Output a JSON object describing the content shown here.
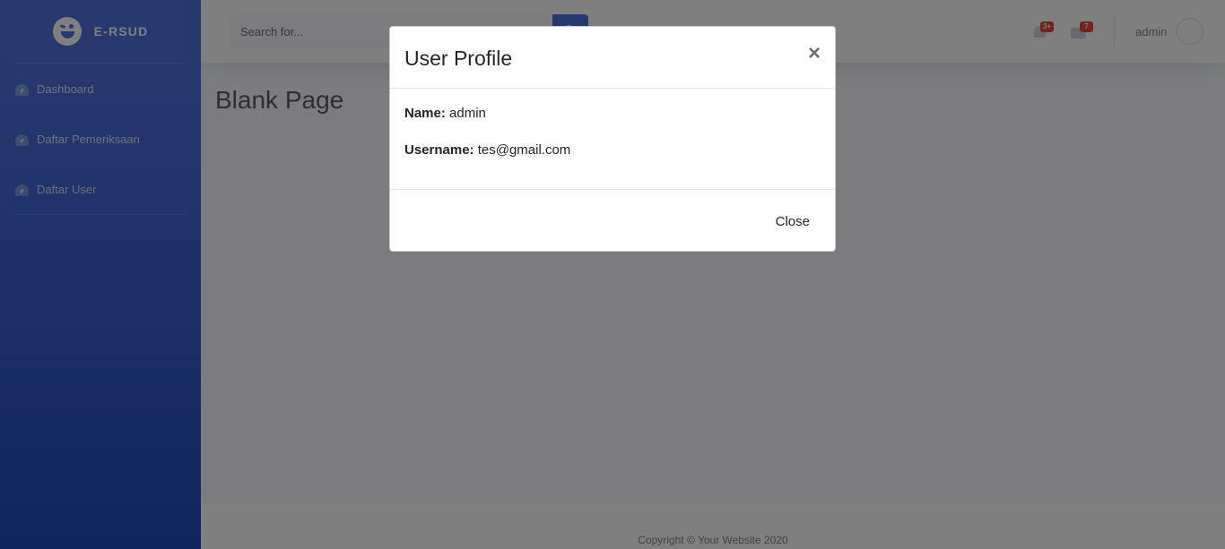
{
  "sidebar": {
    "brand": "E-RSUD",
    "items": [
      {
        "label": "Dashboard"
      },
      {
        "label": "Daftar Pemeriksaan"
      },
      {
        "label": "Daftar User"
      }
    ]
  },
  "topbar": {
    "search_placeholder": "Search for...",
    "alerts_badge": "3+",
    "messages_badge": "7",
    "user_name": "admin"
  },
  "main": {
    "page_title": "Blank Page"
  },
  "footer": {
    "copyright": "Copyright © Your Website 2020"
  },
  "modal": {
    "title": "User Profile",
    "close_icon": "×",
    "name_label": "Name:",
    "name_value": "admin",
    "username_label": "Username:",
    "username_value": "tes@gmail.com",
    "close_button": "Close"
  },
  "colors": {
    "primary": "#4e73df",
    "danger": "#e74a3b"
  }
}
